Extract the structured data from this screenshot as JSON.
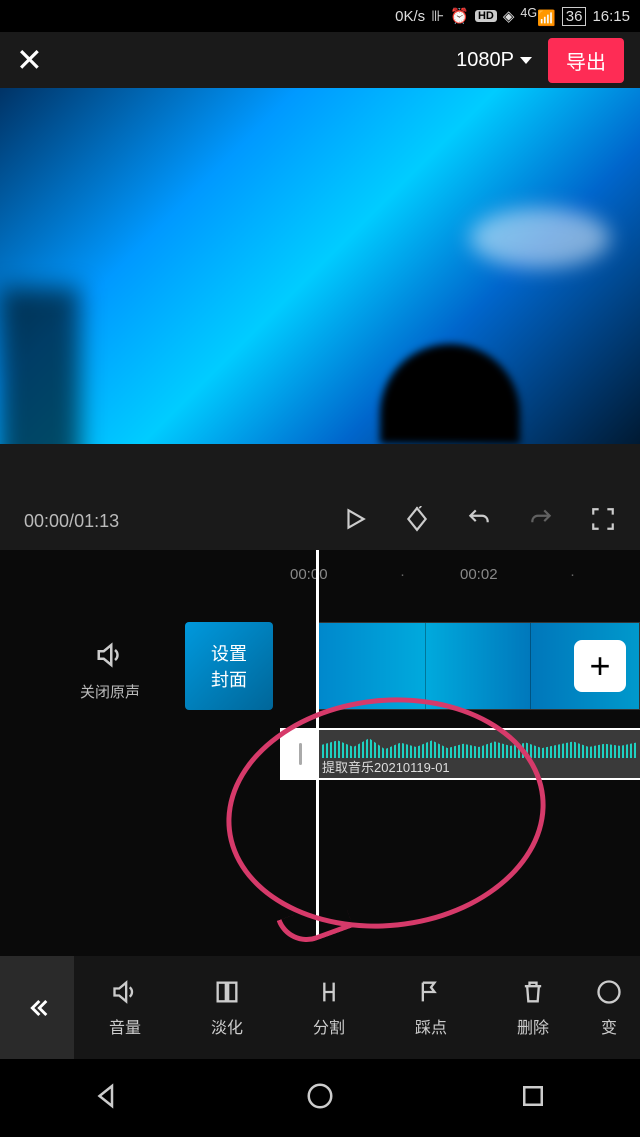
{
  "status": {
    "speed": "0K/s",
    "battery": "36",
    "time": "16:15"
  },
  "topbar": {
    "resolution": "1080P",
    "export": "导出"
  },
  "playback": {
    "current_time": "00:00",
    "total_time": "01:13"
  },
  "ruler": {
    "t0": "00:00",
    "t1": "00:02"
  },
  "timeline": {
    "mute_label": "关闭原声",
    "cover_label": "设置\n封面",
    "audio_clip_label": "提取音乐20210119-01"
  },
  "toolbar": {
    "items": [
      {
        "label": "音量",
        "icon": "volume-icon"
      },
      {
        "label": "淡化",
        "icon": "fade-icon"
      },
      {
        "label": "分割",
        "icon": "split-icon"
      },
      {
        "label": "踩点",
        "icon": "beat-icon"
      },
      {
        "label": "删除",
        "icon": "delete-icon"
      },
      {
        "label": "变",
        "icon": "transform-icon"
      }
    ]
  }
}
